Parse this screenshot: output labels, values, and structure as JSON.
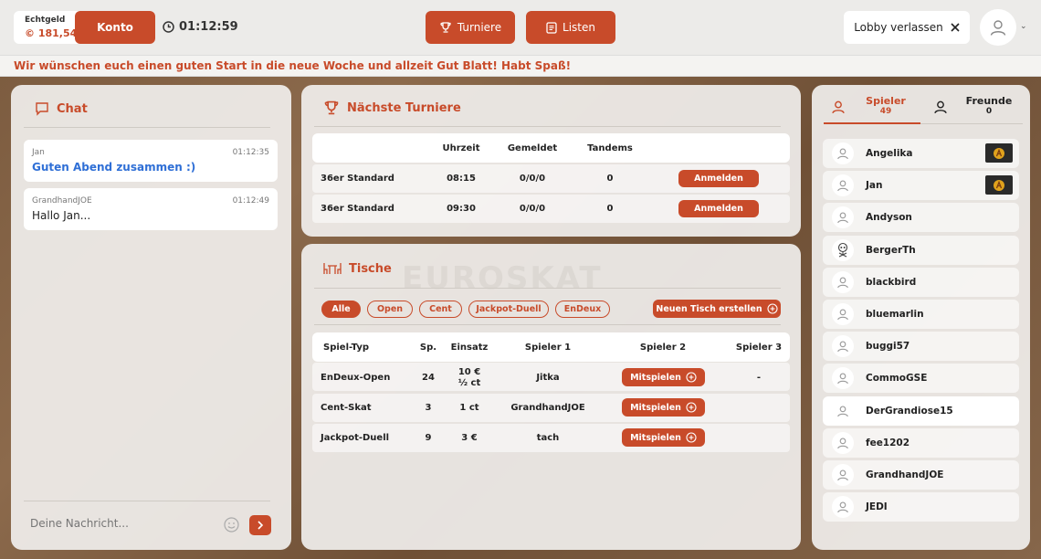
{
  "header": {
    "wallet_label": "Echtgeld",
    "wallet_value": "© 181,54",
    "konto_label": "Konto",
    "timer": "01:12:59",
    "turniere_label": "Turniere",
    "listen_label": "Listen",
    "lobby_label": "Lobby verlassen"
  },
  "marquee": "Wir wünschen euch einen guten Start in die neue Woche und allzeit Gut Blatt! Habt Spaß!",
  "chat": {
    "title": "Chat",
    "messages": [
      {
        "user": "Jan",
        "time": "01:12:35",
        "text": "Guten Abend zusammen :)"
      },
      {
        "user": "GrandhandJOE",
        "time": "01:12:49",
        "text": "Hallo Jan..."
      }
    ],
    "placeholder": "Deine Nachricht..."
  },
  "tournaments": {
    "title": "Nächste Turniere",
    "headers": [
      "Uhrzeit",
      "Gemeldet",
      "Tandems"
    ],
    "rows": [
      {
        "name": "36er Standard",
        "time": "08:15",
        "registered": "0/0/0",
        "tandems": "0",
        "action": "Anmelden"
      },
      {
        "name": "36er Standard",
        "time": "09:30",
        "registered": "0/0/0",
        "tandems": "0",
        "action": "Anmelden"
      }
    ]
  },
  "tables": {
    "title": "Tische",
    "watermark": "EUROSKAT",
    "filters": [
      "Alle",
      "Open",
      "Cent",
      "Jackpot-Duell",
      "EnDeux"
    ],
    "create_label": "Neuen Tisch erstellen",
    "headers": [
      "Spiel-Typ",
      "Sp.",
      "Einsatz",
      "Spieler 1",
      "Spieler 2",
      "Spieler 3"
    ],
    "rows": [
      {
        "type": "EnDeux-Open",
        "sp": "24",
        "stake": "10 €",
        "stake2": "½ ct",
        "p1": "Jitka",
        "action": "Mitspielen",
        "p3": "-"
      },
      {
        "type": "Cent-Skat",
        "sp": "3",
        "stake": "1 ct",
        "stake2": "",
        "p1": "GrandhandJOE",
        "action": "Mitspielen",
        "p3": ""
      },
      {
        "type": "Jackpot-Duell",
        "sp": "9",
        "stake": "3 €",
        "stake2": "",
        "p1": "tach",
        "action": "Mitspielen",
        "p3": ""
      }
    ]
  },
  "players": {
    "tab_players": "Spieler",
    "tab_players_count": "49",
    "tab_friends": "Freunde",
    "tab_friends_count": "0",
    "list": [
      "Angelika",
      "Jan",
      "Andyson",
      "BergerTh",
      "blackbird",
      "bluemarlin",
      "buggi57",
      "CommoGSE",
      "DerGrandiose15",
      "fee1202",
      "GrandhandJOE",
      "JEDI"
    ]
  },
  "colors": {
    "accent": "#c84b2a",
    "link": "#2f6fd6"
  }
}
